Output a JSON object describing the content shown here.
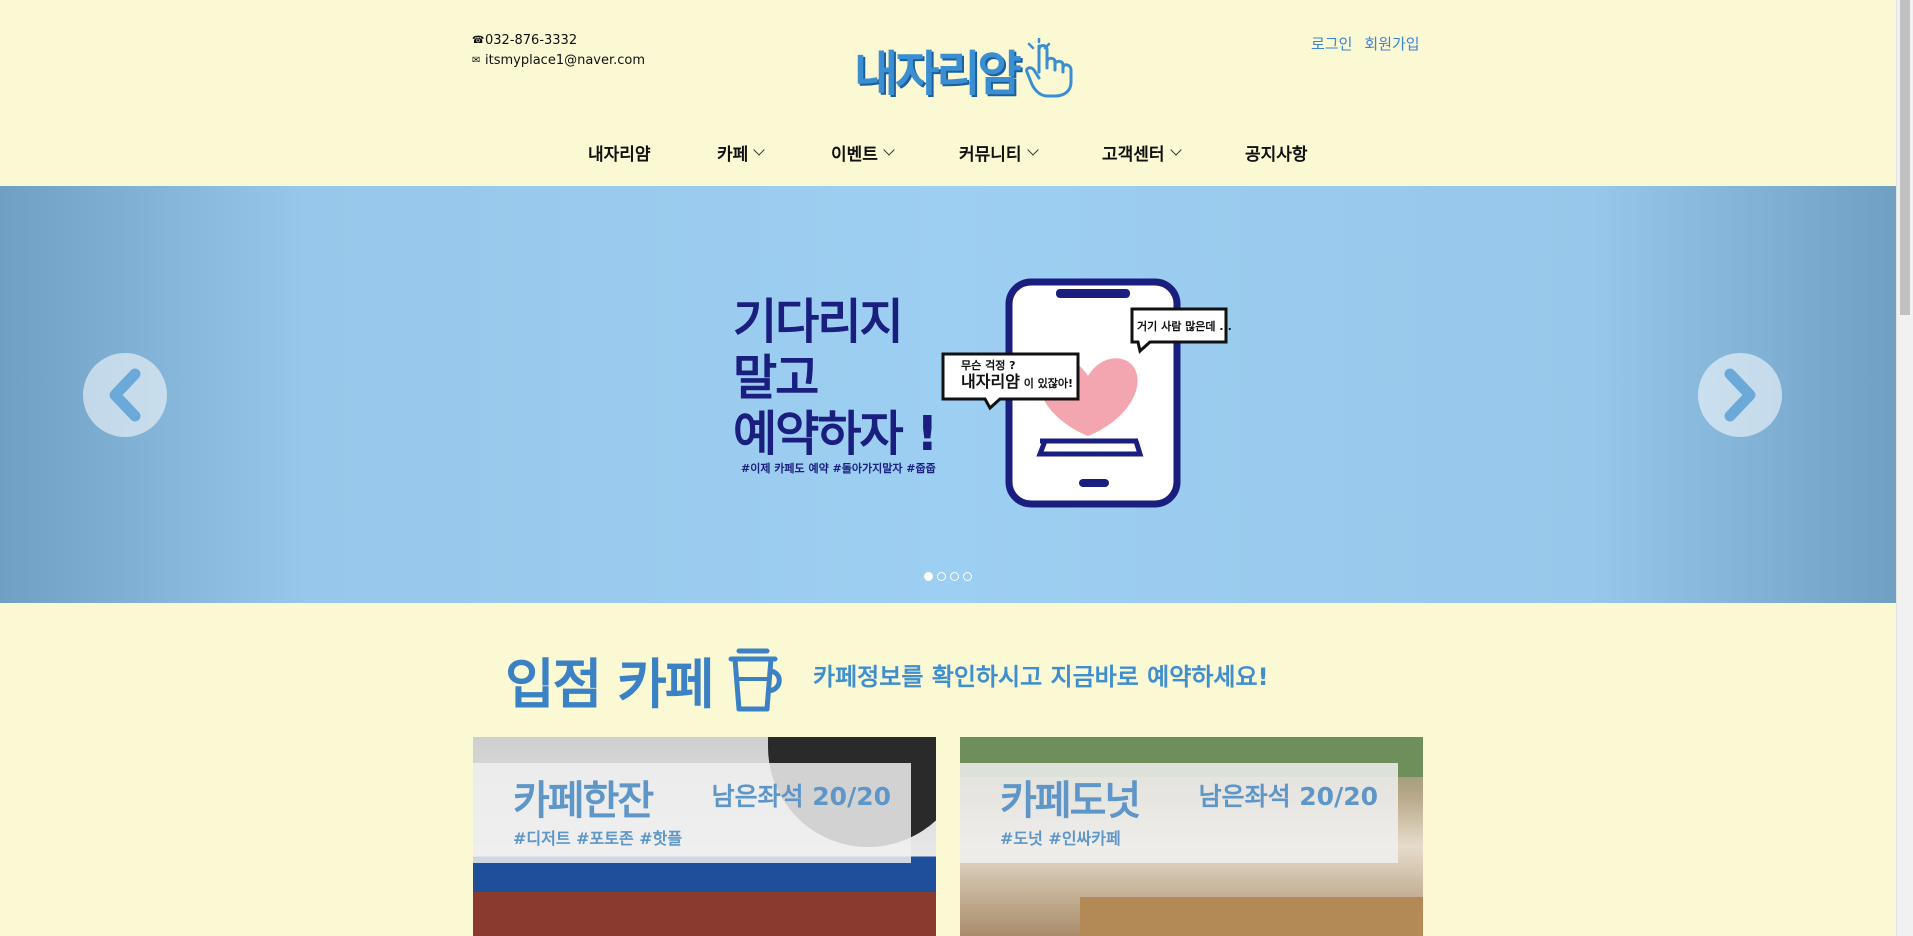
{
  "header": {
    "phone": "032-876-3332",
    "email": "itsmyplace1@naver.com",
    "logo_text": "내자리얌",
    "login": "로그인",
    "signup": "회원가입"
  },
  "nav": {
    "items": [
      {
        "label": "내자리얌",
        "has_dropdown": false
      },
      {
        "label": "카페",
        "has_dropdown": true
      },
      {
        "label": "이벤트",
        "has_dropdown": true
      },
      {
        "label": "커뮤니티",
        "has_dropdown": true
      },
      {
        "label": "고객센터",
        "has_dropdown": true
      },
      {
        "label": "공지사항",
        "has_dropdown": false
      }
    ]
  },
  "banner": {
    "headline": [
      "기다리지",
      "말고",
      "예약하자 !"
    ],
    "tags": "#이제 카페도 예약 #돌아가지말자 #줍줍",
    "bubble_small": "무슨 걱정 ?",
    "bubble_brand": "내자리얌",
    "bubble_suffix": "이 있잖아!",
    "bubble_right": "거기 사람 많은데 ...",
    "slide_count": 4,
    "active_slide": 1
  },
  "section": {
    "title": "입점 카페",
    "subtitle": "카페정보를 확인하시고 지금바로 예약하세요!"
  },
  "cafes": [
    {
      "name": "카페한잔",
      "seats": "남은좌석 20/20",
      "tags": "#디저트 #포토존 #핫플"
    },
    {
      "name": "카페도넛",
      "seats": "남은좌석 20/20",
      "tags": "#도넛 #인싸카페"
    }
  ],
  "colors": {
    "background": "#fbf8d4",
    "brand_blue": "#3a8fd3",
    "banner_blue": "#9dcff2",
    "navy": "#1a1f7f"
  }
}
